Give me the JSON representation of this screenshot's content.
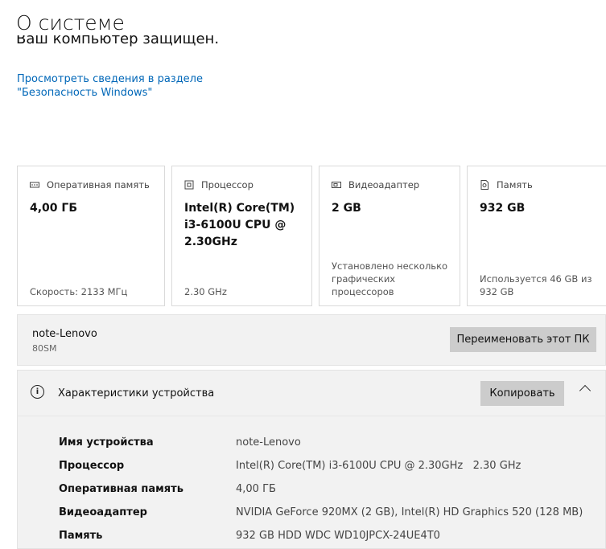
{
  "header": {
    "title": "О системе",
    "protected_text": "Ваш компьютер защищен.",
    "security_link": "Просмотреть сведения в разделе \"Безопасность Windows\""
  },
  "cards": [
    {
      "label": "Оперативная память",
      "icon": "ram-icon",
      "value": "4,00 ГБ",
      "footer": "Скорость: 2133 МГц"
    },
    {
      "label": "Процессор",
      "icon": "cpu-icon",
      "value": "Intel(R) Core(TM) i3-6100U CPU @ 2.30GHz",
      "footer": "2.30 GHz"
    },
    {
      "label": "Видеоадаптер",
      "icon": "gpu-icon",
      "value": "2 GB",
      "footer": "Установлено несколько графических процессоров"
    },
    {
      "label": "Память",
      "icon": "storage-icon",
      "value": "932 GB",
      "footer": "Используется 46 GB из 932 GB"
    }
  ],
  "device": {
    "name": "note-Lenovo",
    "model": "80SM",
    "rename_button": "Переименовать этот ПК"
  },
  "specs": {
    "title": "Характеристики устройства",
    "copy_button": "Копировать",
    "rows": [
      {
        "key": "Имя устройства",
        "value": "note-Lenovo"
      },
      {
        "key": "Процессор",
        "value": "Intel(R) Core(TM) i3-6100U CPU @ 2.30GHz   2.30 GHz"
      },
      {
        "key": "Оперативная память",
        "value": "4,00 ГБ"
      },
      {
        "key": "Видеоадаптер",
        "value": "NVIDIA GeForce 920MX (2 GB), Intel(R) HD Graphics 520 (128 MB)"
      },
      {
        "key": "Память",
        "value": "932 GB HDD WDC WD10JPCX-24UE4T0"
      }
    ]
  },
  "colors": {
    "accent_link": "#0067b8",
    "panel_bg": "#f2f2f2",
    "button_bg": "#cccccc"
  }
}
